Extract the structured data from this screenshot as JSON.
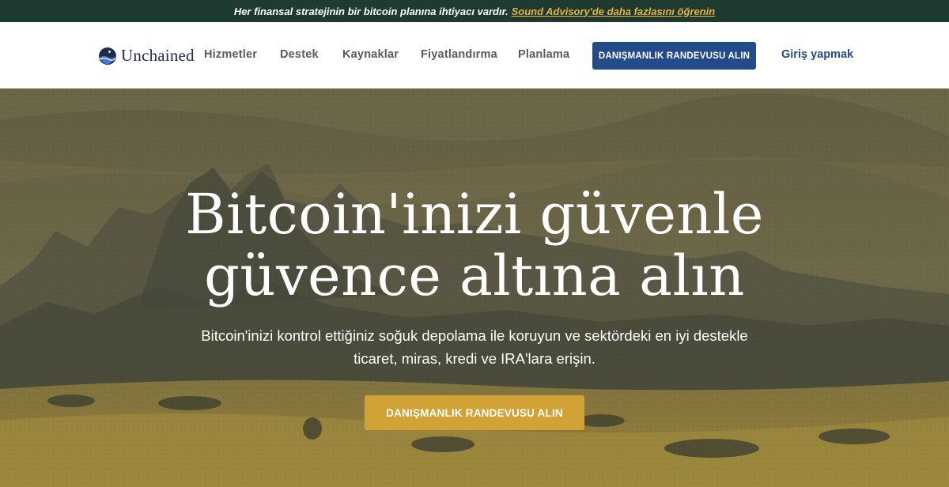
{
  "announcement": {
    "text": "Her finansal stratejinin bir bitcoin planına ihtiyacı vardır.",
    "link_text": "Sound Advisory'de daha fazlasını öğrenin"
  },
  "nav": {
    "logo_text": "Unchained",
    "items": [
      "Hizmetler",
      "Destek",
      "Kaynaklar",
      "Fiyatlandırma",
      "Planlama"
    ],
    "cta_label": "DANIŞMANLIK RANDEVUSU ALIN",
    "login_label": "Giriş yapmak"
  },
  "hero": {
    "title_line1": "Bitcoin'inizi güvenle",
    "title_line2": "güvence altına alın",
    "subtitle_line1": "Bitcoin'inizi kontrol ettiğiniz soğuk depolama ile koruyun ve sektördeki en iyi destekle",
    "subtitle_line2": "ticaret, miras, kredi ve IRA'lara erişin.",
    "cta_label": "DANIŞMANLIK RANDEVUSU ALIN"
  },
  "colors": {
    "announcement_bg": "#1f3b2f",
    "announcement_link": "#e3b24a",
    "brand_navy": "#234b8a",
    "hero_cta": "#d1a236"
  },
  "icons": {
    "logo": "unchained-logo-icon"
  }
}
